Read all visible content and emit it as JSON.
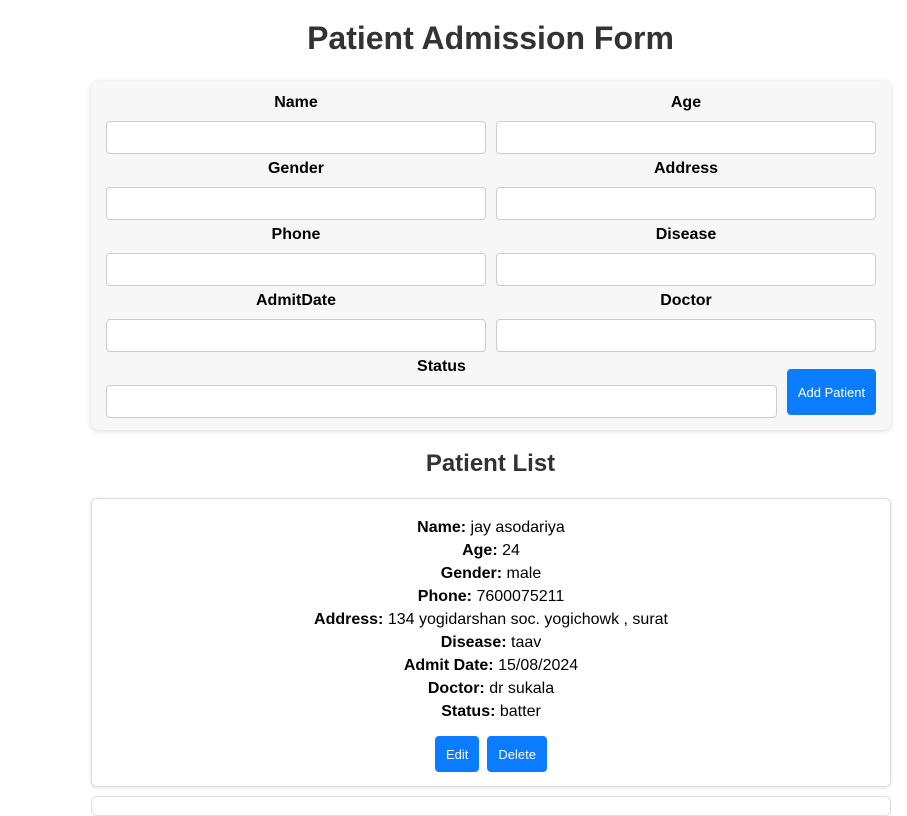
{
  "page": {
    "title": "Patient Admission Form"
  },
  "form": {
    "fields": [
      {
        "label": "Name",
        "value": ""
      },
      {
        "label": "Age",
        "value": ""
      },
      {
        "label": "Gender",
        "value": ""
      },
      {
        "label": "Address",
        "value": ""
      },
      {
        "label": "Phone",
        "value": ""
      },
      {
        "label": "Disease",
        "value": ""
      },
      {
        "label": "AdmitDate",
        "value": ""
      },
      {
        "label": "Doctor",
        "value": ""
      },
      {
        "label": "Status",
        "value": ""
      }
    ],
    "submit_label": "Add Patient"
  },
  "list": {
    "title": "Patient List",
    "patients": [
      {
        "rows": [
          {
            "label": "Name:",
            "value": "jay asodariya"
          },
          {
            "label": "Age:",
            "value": "24"
          },
          {
            "label": "Gender:",
            "value": "male"
          },
          {
            "label": "Phone:",
            "value": "7600075211"
          },
          {
            "label": "Address:",
            "value": "134 yogidarshan soc. yogichowk , surat"
          },
          {
            "label": "Disease:",
            "value": "taav"
          },
          {
            "label": "Admit Date:",
            "value": "15/08/2024"
          },
          {
            "label": "Doctor:",
            "value": "dr sukala"
          },
          {
            "label": "Status:",
            "value": "batter"
          }
        ],
        "edit_label": "Edit",
        "delete_label": "Delete"
      }
    ]
  },
  "colors": {
    "accent": "#0a7cff",
    "heading": "#333333",
    "form_background": "#f7f7f7"
  }
}
